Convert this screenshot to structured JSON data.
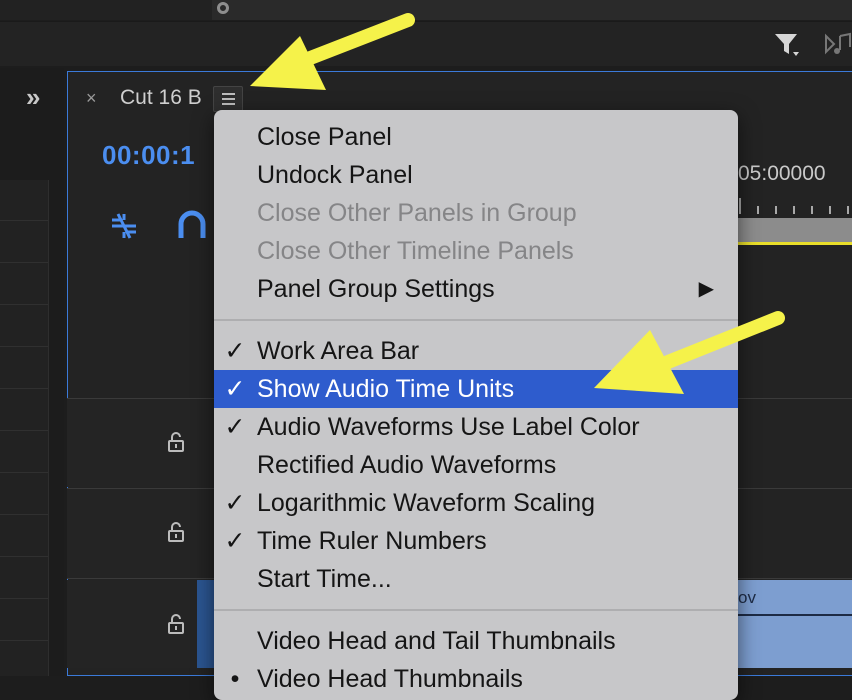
{
  "tab": {
    "close_glyph": "×",
    "title": "Cut 16 B"
  },
  "timecode": "00:00:1",
  "ruler": {
    "label": "05:00000"
  },
  "clip": {
    "label_fragment": "ov"
  },
  "icons": {
    "expand": "»",
    "filter": "filter-icon",
    "audio": "audio-icon",
    "hamburger": "hamburger-menu-icon",
    "snap": "snap-icon",
    "magnet": "magnet-icon",
    "lock": "lock-icon"
  },
  "menu": {
    "items": [
      {
        "label": "Close Panel",
        "checked": false,
        "disabled": false
      },
      {
        "label": "Undock Panel",
        "checked": false,
        "disabled": false
      },
      {
        "label": "Close Other Panels in Group",
        "checked": false,
        "disabled": true
      },
      {
        "label": "Close Other Timeline Panels",
        "checked": false,
        "disabled": true
      },
      {
        "label": "Panel Group Settings",
        "checked": false,
        "disabled": false,
        "submenu_arrow": "▶"
      },
      {
        "label": "Work Area Bar",
        "checked": true,
        "disabled": false
      },
      {
        "label": "Show Audio Time Units",
        "checked": true,
        "disabled": false,
        "selected": true
      },
      {
        "label": "Audio Waveforms Use Label Color",
        "checked": true,
        "disabled": false
      },
      {
        "label": "Rectified Audio Waveforms",
        "checked": false,
        "disabled": false
      },
      {
        "label": "Logarithmic Waveform Scaling",
        "checked": true,
        "disabled": false
      },
      {
        "label": "Time Ruler Numbers",
        "checked": true,
        "disabled": false
      },
      {
        "label": "Start Time...",
        "checked": false,
        "disabled": false
      },
      {
        "label": "Video Head and Tail Thumbnails",
        "checked": false,
        "disabled": false
      },
      {
        "label": "Video Head Thumbnails",
        "checked": false,
        "disabled": false,
        "bullet": "•"
      }
    ],
    "check_glyph": "✓"
  },
  "colors": {
    "accent": "#2e5ccd",
    "timecode": "#4b8ef0",
    "annotation_arrow": "#f5f24a",
    "panel_border": "#3b7ad9"
  }
}
